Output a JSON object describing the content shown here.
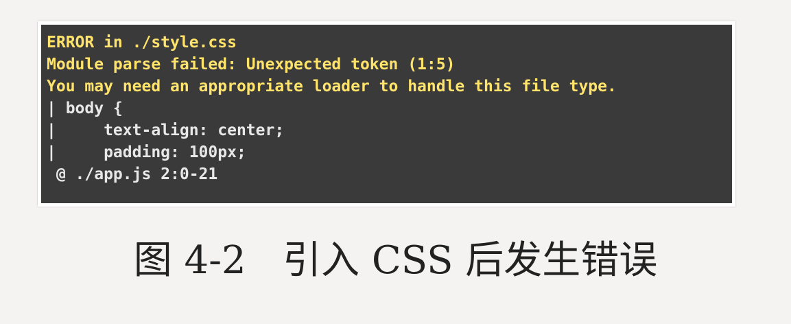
{
  "terminal": {
    "lines": [
      "ERROR in ./style.css",
      "Module parse failed: Unexpected token (1:5)",
      "You may need an appropriate loader to handle this file type.",
      "| body {",
      "|     text-align: center;",
      "|     padding: 100px;",
      " @ ./app.js 2:0-21"
    ]
  },
  "caption": {
    "text": "图 4-2   引入 CSS 后发生错误"
  }
}
